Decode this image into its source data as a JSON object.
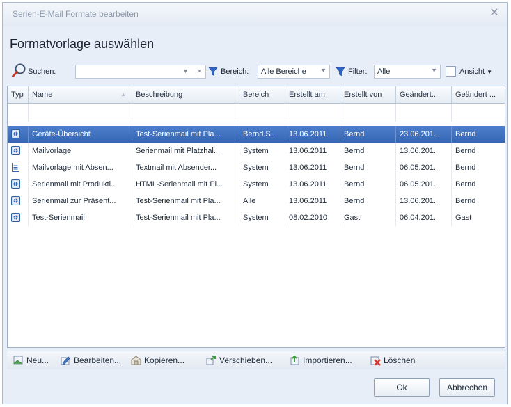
{
  "window": {
    "title": "Serien-E-Mail Formate bearbeiten"
  },
  "heading": "Formatvorlage auswählen",
  "search": {
    "label": "Suchen:",
    "value": ""
  },
  "bereich": {
    "label": "Bereich:",
    "value": "Alle Bereiche"
  },
  "filter": {
    "label": "Filter:",
    "value": "Alle"
  },
  "ansicht": {
    "label": "Ansicht"
  },
  "columns": [
    {
      "label": "Typ"
    },
    {
      "label": "Name"
    },
    {
      "label": "Beschreibung"
    },
    {
      "label": "Bereich"
    },
    {
      "label": "Erstellt am"
    },
    {
      "label": "Erstellt von"
    },
    {
      "label": "Geändert..."
    },
    {
      "label": "Geändert ..."
    }
  ],
  "rows": [
    {
      "icon": "html-mail-icon",
      "selected": true,
      "cells": [
        "Geräte-Übersicht",
        "Test-Serienmail mit Pla...",
        "Bernd S...",
        "13.06.2011",
        "Bernd",
        "23.06.201...",
        "Bernd"
      ]
    },
    {
      "icon": "html-mail-icon",
      "selected": false,
      "cells": [
        "Mailvorlage",
        "Serienmail mit Platzhal...",
        "System",
        "13.06.2011",
        "Bernd",
        "13.06.201...",
        "Bernd"
      ]
    },
    {
      "icon": "text-mail-icon",
      "selected": false,
      "cells": [
        "Mailvorlage mit Absen...",
        "Textmail mit Absender...",
        "System",
        "13.06.2011",
        "Bernd",
        "06.05.201...",
        "Bernd"
      ]
    },
    {
      "icon": "html-mail-icon",
      "selected": false,
      "cells": [
        "Serienmail mit Produkti...",
        "HTML-Serienmail mit Pl...",
        "System",
        "13.06.2011",
        "Bernd",
        "06.05.201...",
        "Bernd"
      ]
    },
    {
      "icon": "html-mail-icon",
      "selected": false,
      "cells": [
        "Serienmail zur Präsent...",
        "Test-Serienmail mit Pla...",
        "Alle",
        "13.06.2011",
        "Bernd",
        "13.06.201...",
        "Bernd"
      ]
    },
    {
      "icon": "html-mail-icon",
      "selected": false,
      "cells": [
        "Test-Serienmail",
        "Test-Serienmail mit Pla...",
        "System",
        "08.02.2010",
        "Gast",
        "06.04.201...",
        "Gast"
      ]
    }
  ],
  "toolbar": {
    "new": "Neu...",
    "edit": "Bearbeiten...",
    "copy": "Kopieren...",
    "move": "Verschieben...",
    "import": "Importieren...",
    "delete": "Löschen"
  },
  "buttons": {
    "ok": "Ok",
    "cancel": "Abbrechen"
  },
  "colors": {
    "selection": "#3d6fbf",
    "accent_blue": "#2f67c9",
    "delete_red": "#d9362b"
  }
}
